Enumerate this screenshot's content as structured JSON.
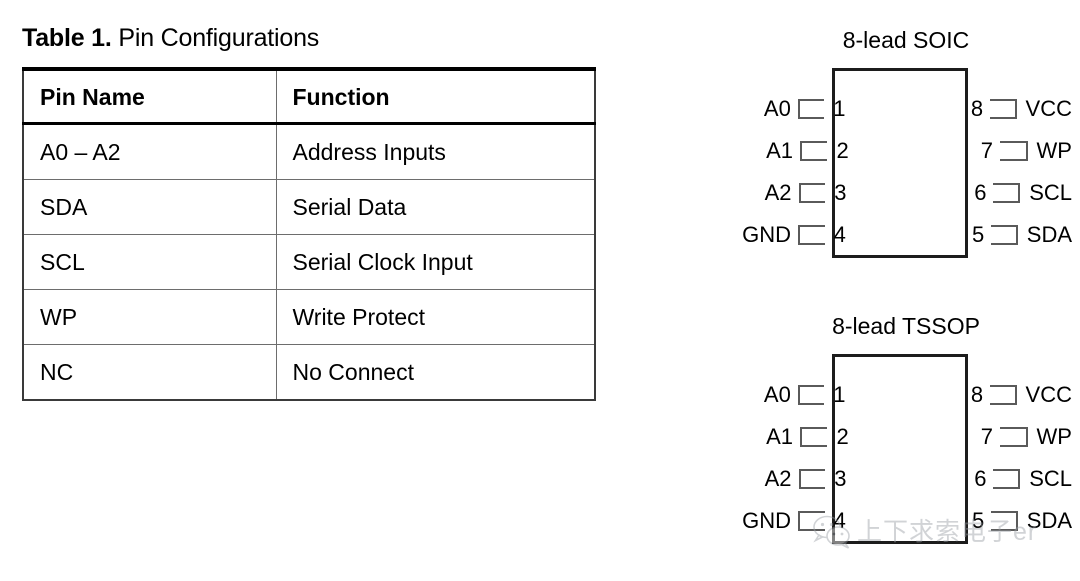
{
  "table": {
    "caption_label": "Table 1.",
    "caption_text": "Pin Configurations",
    "headers": [
      "Pin Name",
      "Function"
    ],
    "rows": [
      {
        "pin_name": "A0 – A2",
        "function": "Address Inputs"
      },
      {
        "pin_name": "SDA",
        "function": "Serial Data"
      },
      {
        "pin_name": "SCL",
        "function": "Serial Clock Input"
      },
      {
        "pin_name": "WP",
        "function": "Write Protect"
      },
      {
        "pin_name": "NC",
        "function": "No Connect"
      }
    ]
  },
  "packages": [
    {
      "title": "8-lead SOIC",
      "left_pins": [
        {
          "num": "1",
          "label": "A0"
        },
        {
          "num": "2",
          "label": "A1"
        },
        {
          "num": "3",
          "label": "A2"
        },
        {
          "num": "4",
          "label": "GND"
        }
      ],
      "right_pins": [
        {
          "num": "8",
          "label": "VCC"
        },
        {
          "num": "7",
          "label": "WP"
        },
        {
          "num": "6",
          "label": "SCL"
        },
        {
          "num": "5",
          "label": "SDA"
        }
      ]
    },
    {
      "title": "8-lead TSSOP",
      "left_pins": [
        {
          "num": "1",
          "label": "A0"
        },
        {
          "num": "2",
          "label": "A1"
        },
        {
          "num": "3",
          "label": "A2"
        },
        {
          "num": "4",
          "label": "GND"
        }
      ],
      "right_pins": [
        {
          "num": "8",
          "label": "VCC"
        },
        {
          "num": "7",
          "label": "WP"
        },
        {
          "num": "6",
          "label": "SCL"
        },
        {
          "num": "5",
          "label": "SDA"
        }
      ]
    }
  ],
  "watermark": {
    "icon": "wechat-icon",
    "text": "上下求索电子er",
    "color": "#9aa0a6"
  }
}
